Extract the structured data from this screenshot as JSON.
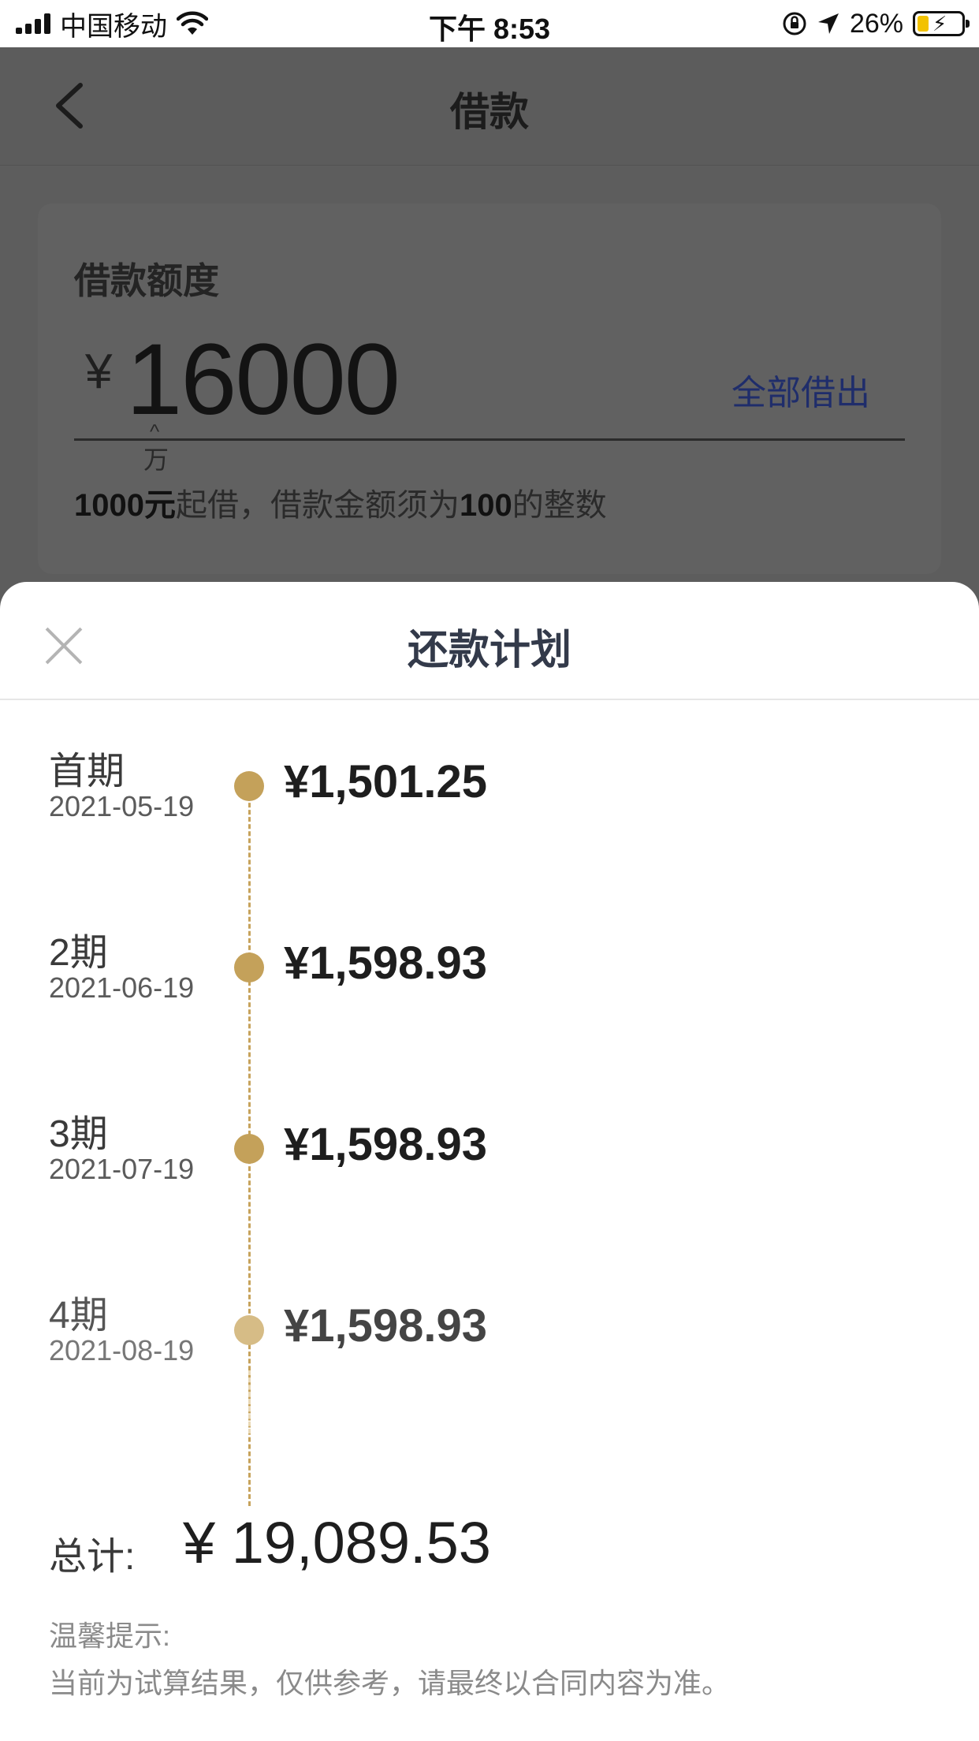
{
  "status_bar": {
    "carrier": "中国移动",
    "time": "下午 8:53",
    "battery_percent": "26%",
    "battery_level": 0.26,
    "icons": [
      "signal-icon",
      "wifi-icon",
      "orientation-lock-icon",
      "location-icon",
      "battery-icon"
    ]
  },
  "nav": {
    "title": "借款",
    "back_icon": "chevron-left-icon"
  },
  "loan": {
    "label": "借款额度",
    "currency": "¥",
    "amount": "16000",
    "unit_caret": "^",
    "unit": "万",
    "borrow_all_label": "全部借出",
    "hint_min": "1000元",
    "hint_mid": "起借，借款金额须为",
    "hint_num": "100",
    "hint_end": "的整数"
  },
  "sheet": {
    "title": "还款计划",
    "close_icon": "close-icon",
    "installments": [
      {
        "period": "首期",
        "date": "2021-05-19",
        "amount": "¥1,501.25"
      },
      {
        "period": "2期",
        "date": "2021-06-19",
        "amount": "¥1,598.93"
      },
      {
        "period": "3期",
        "date": "2021-07-19",
        "amount": "¥1,598.93"
      },
      {
        "period": "4期",
        "date": "2021-08-19",
        "amount": "¥1,598.93"
      }
    ],
    "total_label": "总计:",
    "total_value": "¥ 19,089.53",
    "tip_title": "温馨提示:",
    "tip_text": "当前为试算结果，仅供参考，请最终以合同内容为准。"
  },
  "colors": {
    "accent_gold": "#c4a15a",
    "link_blue": "#1f2d6b",
    "overlay": "#5d5d5d"
  }
}
